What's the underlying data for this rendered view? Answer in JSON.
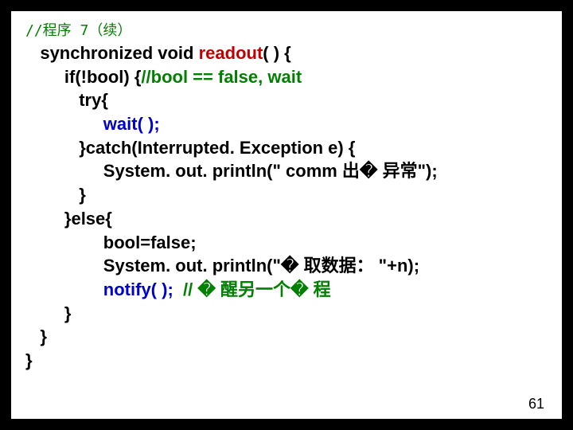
{
  "slide": {
    "header_comment": "//程序 7（续）",
    "code": {
      "l1a": "   synchronized void ",
      "l1b": "readout",
      "l1c": "( ) {",
      "l2a": "        if(!bool) {",
      "l2b": "//bool == false, wait",
      "l3": "           try{",
      "l4a": "                ",
      "l4b": "wait( );",
      "l5": "           }catch(Interrupted. Exception e) {",
      "l6": "                System. out. println(\" comm 出� 异常\");",
      "l7": "           }",
      "l8": "        }else{",
      "l9": "                bool=false;",
      "l10": "                System. out. println(\"� 取数据： \"+n);",
      "l11a": "                ",
      "l11b": "notify( );  ",
      "l11c": "// � 醒另一个� 程",
      "l12": "        }",
      "l13": "   }",
      "l14": "}"
    },
    "page_number": "61"
  }
}
